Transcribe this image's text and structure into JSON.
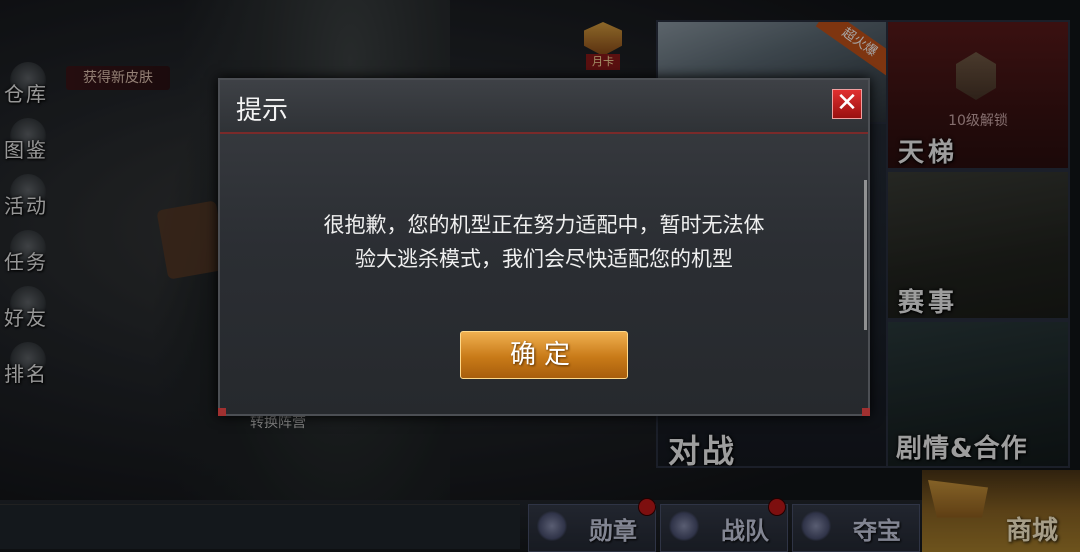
{
  "left_menu": [
    {
      "label": "仓库",
      "icon": "warehouse-icon"
    },
    {
      "label": "图鉴",
      "icon": "codex-icon"
    },
    {
      "label": "活动",
      "icon": "events-icon"
    },
    {
      "label": "任务",
      "icon": "missions-icon"
    },
    {
      "label": "好友",
      "icon": "friends-icon"
    },
    {
      "label": "排名",
      "icon": "ranking-icon"
    }
  ],
  "new_skin_label": "获得新皮肤",
  "monthly_card_label": "月卡",
  "right_panels": {
    "event_badge": "超火爆",
    "ladder": {
      "title": "天梯",
      "lock_text": "10级解锁"
    },
    "tournament": {
      "title": "赛事"
    },
    "story_coop": {
      "title": "剧情&合作"
    },
    "battle": {
      "title": "对战"
    }
  },
  "switch_camp_label": "转换阵营",
  "bottom_tabs": [
    {
      "label": "勋章",
      "icon": "medal-icon",
      "has_dot": true
    },
    {
      "label": "战队",
      "icon": "clan-icon",
      "has_dot": true
    },
    {
      "label": "夺宝",
      "icon": "treasure-icon",
      "has_dot": false
    }
  ],
  "shop_label": "商城",
  "dialog": {
    "title": "提示",
    "message_line1": "很抱歉，您的机型正在努力适配中，暂时无法体",
    "message_line2": "验大逃杀模式，我们会尽快适配您的机型",
    "confirm_label": "确定",
    "close_symbol": "✕"
  },
  "colors": {
    "accent_orange": "#c87a18",
    "close_red": "#c01818",
    "dialog_bg": "#2b2e33"
  }
}
